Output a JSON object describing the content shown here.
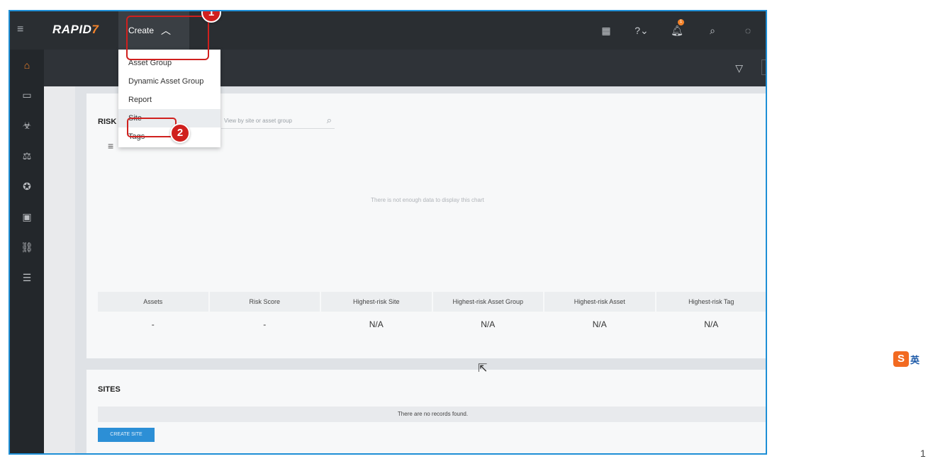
{
  "app": {
    "logo_text": "RAPID",
    "logo_mark": "7"
  },
  "header": {
    "create_label": "Create",
    "icons": [
      "calendar-icon",
      "help-icon",
      "notification-icon",
      "search-icon",
      "user-icon"
    ],
    "notification_count": "1"
  },
  "sidebar": {
    "items": [
      {
        "icon": "home-icon",
        "glyph": "⌂"
      },
      {
        "icon": "monitor-icon",
        "glyph": "▭"
      },
      {
        "icon": "biohazard-icon",
        "glyph": "☣"
      },
      {
        "icon": "policy-icon",
        "glyph": "⚖"
      },
      {
        "icon": "award-icon",
        "glyph": "✪"
      },
      {
        "icon": "reports-icon",
        "glyph": "▣"
      },
      {
        "icon": "link-icon",
        "glyph": "⛓"
      },
      {
        "icon": "list-icon",
        "glyph": "☰"
      }
    ]
  },
  "create_menu": {
    "items": [
      "Asset Group",
      "Dynamic Asset Group",
      "Report",
      "Site",
      "Tags"
    ]
  },
  "risk_card": {
    "title": "RISK",
    "search_placeholder": "View by site or asset group",
    "empty_chart_message": "There is not enough data to display this chart",
    "stats_headers": [
      "Assets",
      "Risk Score",
      "Highest-risk Site",
      "Highest-risk Asset Group",
      "Highest-risk Asset",
      "Highest-risk Tag"
    ],
    "stats_values": [
      "-",
      "-",
      "N/A",
      "N/A",
      "N/A",
      "N/A"
    ]
  },
  "sites_card": {
    "title": "SITES",
    "empty_message": "There are no records found.",
    "create_button": "CREATE SITE"
  },
  "annotations": {
    "step1": "1",
    "step2": "2"
  },
  "tray": {
    "ime_logo": "S",
    "ime_text": "英"
  },
  "corner_text": "1"
}
